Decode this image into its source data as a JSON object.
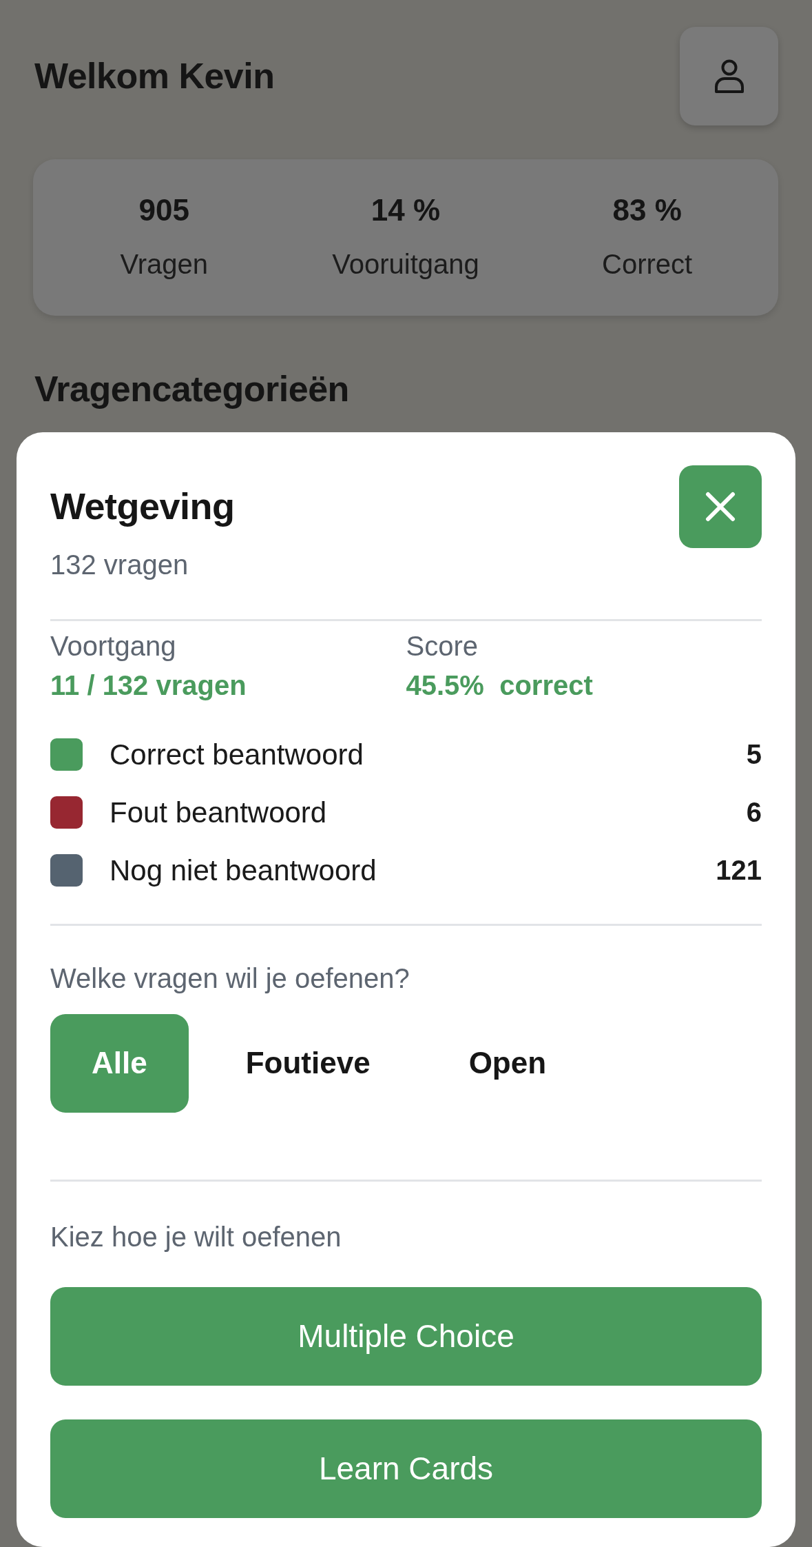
{
  "header": {
    "title": "Welkom Kevin"
  },
  "stats": [
    {
      "value": "905",
      "label": "Vragen"
    },
    {
      "value": "14 %",
      "label": "Vooruitgang"
    },
    {
      "value": "83 %",
      "label": "Correct"
    }
  ],
  "section_title": "Vragencategorieën",
  "sheet": {
    "title": "Wetgeving",
    "subtitle": "132 vragen",
    "progress": {
      "label": "Voortgang",
      "value": "11 / 132 vragen"
    },
    "score": {
      "label": "Score",
      "value": "45.5%  correct"
    },
    "legend": [
      {
        "label": "Correct beantwoord",
        "count": "5",
        "color": "#4a9b5d"
      },
      {
        "label": "Fout beantwoord",
        "count": "6",
        "color": "#972731"
      },
      {
        "label": "Nog niet beantwoord",
        "count": "121",
        "color": "#556370"
      }
    ],
    "filter": {
      "prompt": "Welke vragen wil je oefenen?",
      "options": [
        {
          "label": "Alle",
          "selected": true
        },
        {
          "label": "Foutieve",
          "selected": false
        },
        {
          "label": "Open",
          "selected": false
        }
      ]
    },
    "mode": {
      "prompt": "Kiez hoe je wilt oefenen",
      "buttons": [
        "Multiple Choice",
        "Learn Cards"
      ]
    }
  }
}
